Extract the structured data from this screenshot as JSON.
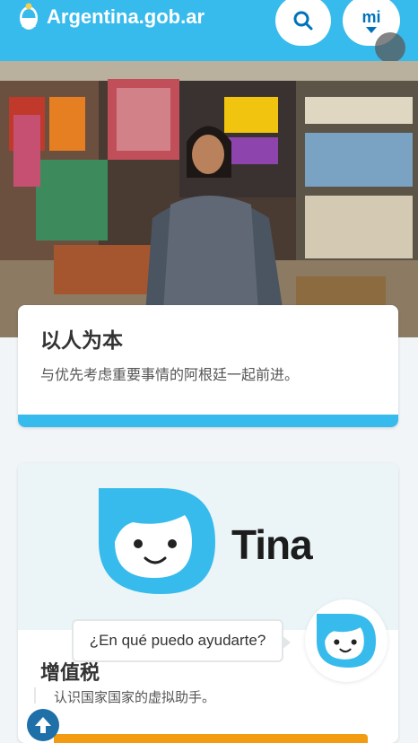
{
  "header": {
    "brand": "Argentina.gob.ar",
    "search_icon": "search-icon",
    "mi_label": "mi",
    "colors": {
      "bar": "#37bbed",
      "button_text": "#0072bb"
    }
  },
  "hero": {
    "title": "以人为本",
    "subtitle": "与优先考虑重要事情的阿根廷一起前进。",
    "accent_color": "#37bbed"
  },
  "tina_card": {
    "logo_word": "Tina",
    "title": "增值税",
    "description": "认识国家国家的虚拟助手。",
    "accent_color": "#f39c12"
  },
  "chatbot": {
    "prompt": "¿En qué puedo ayudarte?",
    "avatar_icon": "tina-face-icon"
  },
  "scroll_top_icon": "arrow-up-icon"
}
